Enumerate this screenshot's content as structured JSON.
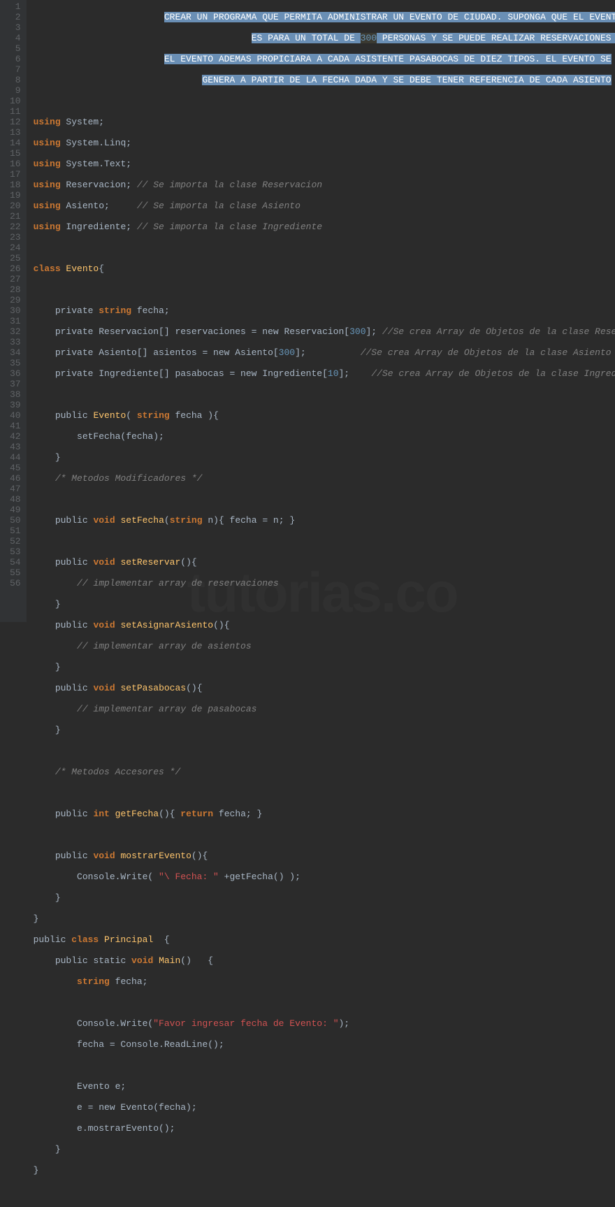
{
  "watermark": "tutorias.co",
  "gutter": [
    "1",
    "2",
    "3",
    "4",
    "5",
    "6",
    "7",
    "8",
    "9",
    "10",
    "11",
    "12",
    "13",
    "14",
    "15",
    "16",
    "17",
    "18",
    "19",
    "20",
    "21",
    "22",
    "23",
    "24",
    "25",
    "26",
    "27",
    "28",
    "29",
    "30",
    "31",
    "32",
    "33",
    "34",
    "35",
    "36",
    "37",
    "38",
    "39",
    "40",
    "41",
    "42",
    "43",
    "44",
    "45",
    "46",
    "47",
    "48",
    "49",
    "50",
    "51",
    "52",
    "53",
    "54",
    "55",
    "56"
  ],
  "t": {
    "h1a": "CREAR UN PROGRAMA QUE PERMITA ADMINISTRAR UN EVENTO DE CIUDAD. SUPONGA QUE EL EVENTO",
    "h2a": "ES PARA UN TOTAL DE ",
    "h2n": "300",
    "h2b": " PERSONAS Y SE PUEDE REALIZAR RESERVACIONES CON ANTELACION.",
    "h3a": "EL EVENTO ADEMAS PROPICIARA A CADA ASISTENTE PASABOCAS DE DIEZ TIPOS. EL EVENTO SE",
    "h4a": "GENERA A PARTIR DE LA FECHA DADA Y SE DEBE TENER REFERENCIA DE CADA ASIENTO",
    "using": "using",
    "sys": " System;",
    "linq": " System.Linq;",
    "text": " System.Text;",
    "reserv": " Reservacion; ",
    "asiento": " Asiento;     ",
    "ingred": " Ingrediente; ",
    "c_reserv": "// Se importa la clase Reservacion",
    "c_asiento": "// Se importa la clase Asiento",
    "c_ingred": "// Se importa la clase Ingrediente",
    "class": "class ",
    "evento": "Evento",
    "obr": "{",
    "priv": "    private ",
    "string": "string",
    "fecha_decl": " fecha;",
    "reserv_arr_a": "    private Reservacion[] reservaciones = new Reservacion[",
    "n300": "300",
    "reserv_arr_b": "]; ",
    "c_arr_reserv": "//Se crea Array de Objetos de la clase Reservacion",
    "asiento_arr_a": "    private Asiento[] asientos = new Asiento[",
    "asiento_arr_b": "];          ",
    "c_arr_asiento": "//Se crea Array de Objetos de la clase Asiento",
    "ingred_arr_a": "    private Ingrediente[] pasabocas = new Ingrediente[",
    "n10": "10",
    "ingred_arr_b": "];    ",
    "c_arr_ingred": "//Se crea Array de Objetos de la clase Ingrediente",
    "pub": "    public ",
    "ctor_sig_a": "( ",
    "ctor_sig_b": " fecha ){",
    "ctor_body": "        setFecha(fecha);",
    "cbr": "    }",
    "c_mod": "    /* Metodos Modificadores */",
    "void": "void",
    "sp": " ",
    "setFecha": "setFecha",
    "setFecha_sig_a": "(",
    "setFecha_sig_b": " n){ fecha = n; }",
    "setReservar": "setReservar",
    "empty_sig": "(){",
    "c_impl_reserv": "        // implementar array de reservaciones",
    "setAsignar": "setAsignarAsiento",
    "c_impl_asiento": "        // implementar array de asientos",
    "setPasabocas": "setPasabocas",
    "c_impl_pas": "        // implementar array de pasabocas",
    "c_acc": "    /* Metodos Accesores */",
    "int": "int",
    "getFecha": "getFecha",
    "getFecha_body": "(){ ",
    "return": "return",
    "getFecha_end": " fecha; }",
    "mostrar": "mostrarEvento",
    "mostrar_body_a": "        Console.Write( ",
    "str_fecha": "\"\\ Fecha: \"",
    "mostrar_body_b": " +getFecha() );",
    "class_cbr": "}",
    "public": "public ",
    "principal": "Principal",
    "principal_sig": "  {",
    "static": "static ",
    "main": "Main",
    "main_sig": "()   {",
    "main_fecha": "        ",
    "main_fecha_decl": " fecha;",
    "console_write": "        Console.Write(",
    "str_favor": "\"Favor ingresar fecha de Evento: \"",
    "console_write_end": ");",
    "readline": "        fecha = Console.ReadLine();",
    "evento_e": "        Evento e;",
    "new_evento": "        e = new Evento(fecha);",
    "e_mostrar": "        e.mostrarEvento();",
    "main_cbr": "    }",
    "final_cbr": "}"
  }
}
